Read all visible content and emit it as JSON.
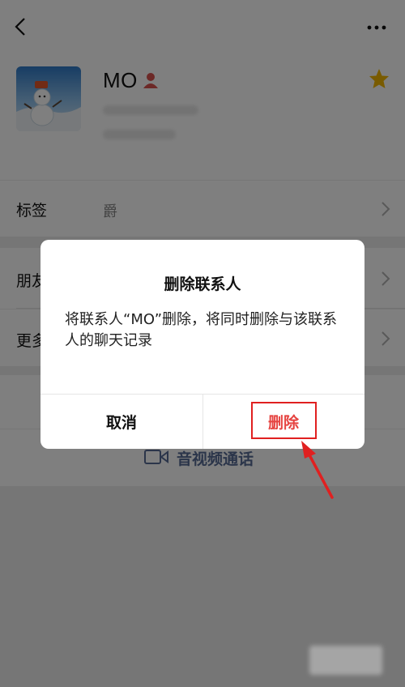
{
  "profile": {
    "name": "MO",
    "back_icon": "chevron-left-icon",
    "more_icon": "more-dots-icon",
    "star_icon": "star-icon",
    "star_color": "#f2b600"
  },
  "rows": {
    "tag_label": "标签",
    "tag_value": "爵",
    "friend_label_partial": "朋友",
    "more_label_partial": "更多"
  },
  "actions": {
    "call_label": "音视频通话",
    "link_color": "#576b95"
  },
  "dialog": {
    "title": "删除联系人",
    "message": "将联系人“MO”删除，将同时删除与该联系人的聊天记录",
    "cancel_label": "取消",
    "delete_label": "删除",
    "delete_color": "#e64340"
  },
  "annotation": {
    "highlight_color": "#e02020"
  }
}
